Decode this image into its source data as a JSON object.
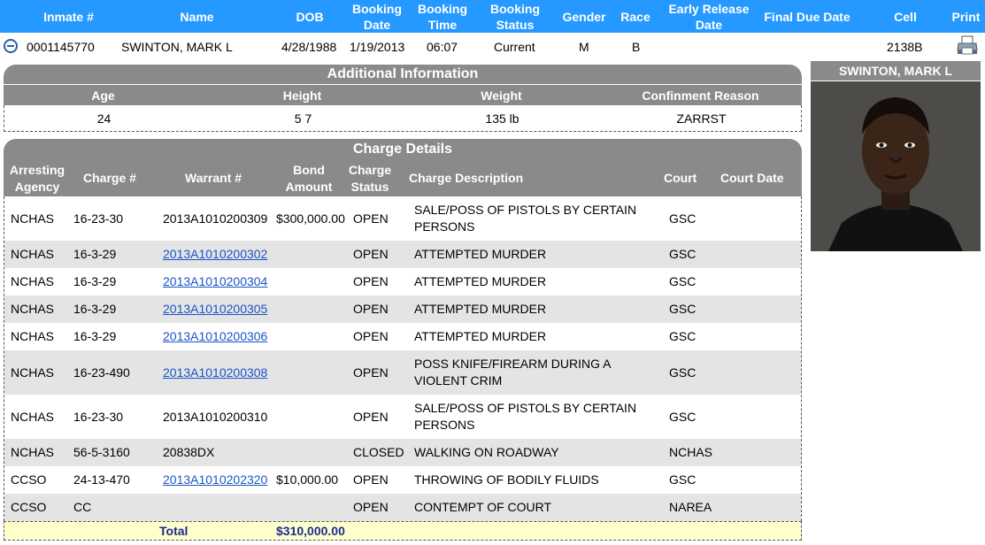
{
  "header": {
    "inmate_no": "Inmate #",
    "name": "Name",
    "dob": "DOB",
    "booking_date": "Booking Date",
    "booking_time": "Booking Time",
    "booking_status": "Booking Status",
    "gender": "Gender",
    "race": "Race",
    "early_release": "Early Release Date",
    "final_due": "Final Due Date",
    "cell": "Cell",
    "print": "Print"
  },
  "inmate": {
    "inmate_no": "0001145770",
    "name": "SWINTON, MARK L",
    "dob": "4/28/1988",
    "booking_date": "1/19/2013",
    "booking_time": "06:07",
    "booking_status": "Current",
    "gender": "M",
    "race": "B",
    "early_release": "",
    "final_due": "",
    "cell": "2138B"
  },
  "additional": {
    "title": "Additional Information",
    "headers": {
      "age": "Age",
      "height": "Height",
      "weight": "Weight",
      "reason": "Confinment Reason"
    },
    "values": {
      "age": "24",
      "height": "5 7",
      "weight": "135 lb",
      "reason": "ZARRST"
    }
  },
  "charges": {
    "title": "Charge Details",
    "headers": {
      "agency": "Arresting Agency",
      "charge_no": "Charge #",
      "warrant": "Warrant #",
      "bond": "Bond Amount",
      "status": "Charge Status",
      "description": "Charge Description",
      "court": "Court",
      "court_date": "Court Date"
    },
    "rows": [
      {
        "agency": "NCHAS",
        "charge_no": "16-23-30",
        "warrant": "2013A1010200309",
        "bond": "$300,000.00",
        "status": "OPEN",
        "description": "SALE/POSS OF PISTOLS BY CERTAIN PERSONS",
        "court": "GSC",
        "court_date": ""
      },
      {
        "agency": "NCHAS",
        "charge_no": "16-3-29",
        "warrant": "2013A1010200302",
        "bond": "",
        "status": "OPEN",
        "description": "ATTEMPTED MURDER",
        "court": "GSC",
        "court_date": ""
      },
      {
        "agency": "NCHAS",
        "charge_no": "16-3-29",
        "warrant": "2013A1010200304",
        "bond": "",
        "status": "OPEN",
        "description": "ATTEMPTED MURDER",
        "court": "GSC",
        "court_date": ""
      },
      {
        "agency": "NCHAS",
        "charge_no": "16-3-29",
        "warrant": "2013A1010200305",
        "bond": "",
        "status": "OPEN",
        "description": "ATTEMPTED MURDER",
        "court": "GSC",
        "court_date": ""
      },
      {
        "agency": "NCHAS",
        "charge_no": "16-3-29",
        "warrant": "2013A1010200306",
        "bond": "",
        "status": "OPEN",
        "description": "ATTEMPTED MURDER",
        "court": "GSC",
        "court_date": ""
      },
      {
        "agency": "NCHAS",
        "charge_no": "16-23-490",
        "warrant": "2013A1010200308",
        "bond": "",
        "status": "OPEN",
        "description": "POSS KNIFE/FIREARM DURING A VIOLENT CRIM",
        "court": "GSC",
        "court_date": ""
      },
      {
        "agency": "NCHAS",
        "charge_no": "16-23-30",
        "warrant": "2013A1010200310",
        "bond": "",
        "status": "OPEN",
        "description": "SALE/POSS OF PISTOLS BY CERTAIN PERSONS",
        "court": "GSC",
        "court_date": ""
      },
      {
        "agency": "NCHAS",
        "charge_no": "56-5-3160",
        "warrant": "20838DX",
        "bond": "",
        "status": "CLOSED",
        "description": "WALKING ON ROADWAY",
        "court": "NCHAS",
        "court_date": ""
      },
      {
        "agency": "CCSO",
        "charge_no": "24-13-470",
        "warrant": "2013A1010202320",
        "bond": "$10,000.00",
        "status": "OPEN",
        "description": "THROWING OF BODILY FLUIDS",
        "court": "GSC",
        "court_date": ""
      },
      {
        "agency": "CCSO",
        "charge_no": "CC",
        "warrant": "",
        "bond": "",
        "status": "OPEN",
        "description": "CONTEMPT OF COURT",
        "court": "NAREA",
        "court_date": ""
      }
    ],
    "total_label": "Total",
    "total_value": "$310,000.00"
  },
  "photo": {
    "caption": "SWINTON, MARK L"
  },
  "icons": {
    "collapse": "minus-circle-icon",
    "print": "printer-icon"
  },
  "colors": {
    "header_blue": "#2599ff",
    "section_gray": "#8a8a8a",
    "link": "#1a55c8",
    "total_bg": "#ffffcc"
  }
}
